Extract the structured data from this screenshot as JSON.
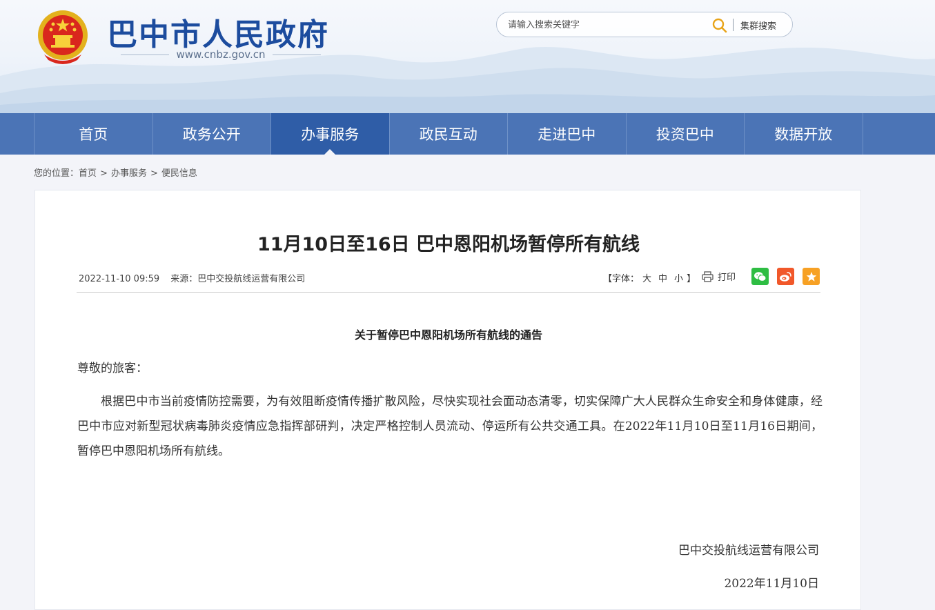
{
  "header": {
    "site_title": "巴中市人民政府",
    "site_url": "www.cnbz.gov.cn",
    "search_placeholder": "请输入搜索关键字",
    "cluster_search_label": "集群搜索"
  },
  "nav": {
    "items": [
      {
        "label": "首页"
      },
      {
        "label": "政务公开"
      },
      {
        "label": "办事服务"
      },
      {
        "label": "政民互动"
      },
      {
        "label": "走进巴中"
      },
      {
        "label": "投资巴中"
      },
      {
        "label": "数据开放"
      }
    ],
    "active_index": 2
  },
  "breadcrumb": {
    "prefix": "您的位置：",
    "items": [
      "首页",
      "办事服务",
      "便民信息"
    ],
    "separator": ">"
  },
  "article": {
    "title": "11月10日至16日 巴中恩阳机场暂停所有航线",
    "date": "2022-11-10 09:59",
    "source": "来源：巴中交投航线运营有限公司",
    "font_label_open": "【字体：",
    "font_sizes": [
      "大",
      "中",
      "小"
    ],
    "font_label_close": "】",
    "print_label": "打印",
    "notice_title": "关于暂停巴中恩阳机场所有航线的通告",
    "greeting": "尊敬的旅客：",
    "paragraph": "根据巴中市当前疫情防控需要，为有效阻断疫情传播扩散风险，尽快实现社会面动态清零，切实保障广大人民群众生命安全和身体健康，经巴中市应对新型冠状病毒肺炎疫情应急指挥部研判，决定严格控制人员流动、停运所有公共交通工具。在2022年11月10日至11月16日期间，暂停巴中恩阳机场所有航线。",
    "signature_org": "巴中交投航线运营有限公司",
    "signature_date": "2022年11月10日"
  },
  "colors": {
    "title_blue": "#1c4c9e",
    "nav_bg": "#4b74b6",
    "nav_active": "#2f5da7",
    "wechat_green": "#2ebd43",
    "weibo_red": "#f1582a",
    "fav_orange": "#f7a124"
  },
  "icons": [
    "national-emblem-icon",
    "search-icon",
    "printer-icon",
    "wechat-icon",
    "weibo-icon",
    "star-icon"
  ]
}
